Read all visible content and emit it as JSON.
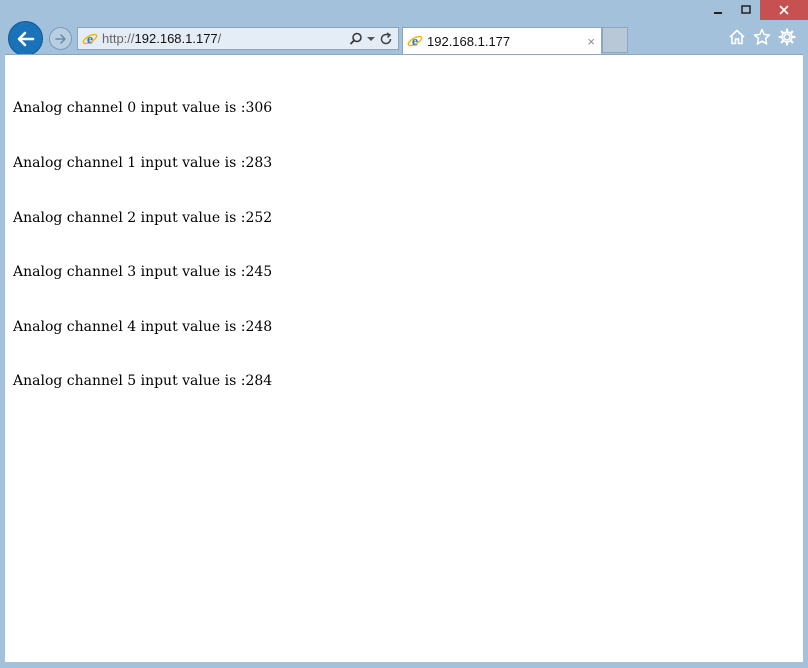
{
  "window": {
    "minimize_glyph": "—",
    "maximize_glyph": "□",
    "close_glyph": "✕"
  },
  "nav": {
    "address": {
      "scheme": "http://",
      "host": "192.168.1.177",
      "path": "/"
    }
  },
  "tab": {
    "title": "192.168.1.177",
    "close": "×"
  },
  "icons": {
    "back": "back-arrow-icon",
    "forward": "forward-arrow-icon",
    "search": "search-icon",
    "dropdown": "chevron-down-icon",
    "refresh": "refresh-icon",
    "home": "home-icon",
    "favorites": "star-icon",
    "tools": "gear-icon"
  },
  "colors": {
    "frame": "#a3c1da",
    "back_button": "#1a73b8",
    "close_button": "#c75050"
  },
  "content": {
    "lines": [
      "Analog channel 0 input value is :306",
      "Analog channel 1 input value is :283",
      "Analog channel 2 input value is :252",
      "Analog channel 3 input value is :245",
      "Analog channel 4 input value is :248",
      "Analog channel 5 input value is :284"
    ]
  }
}
